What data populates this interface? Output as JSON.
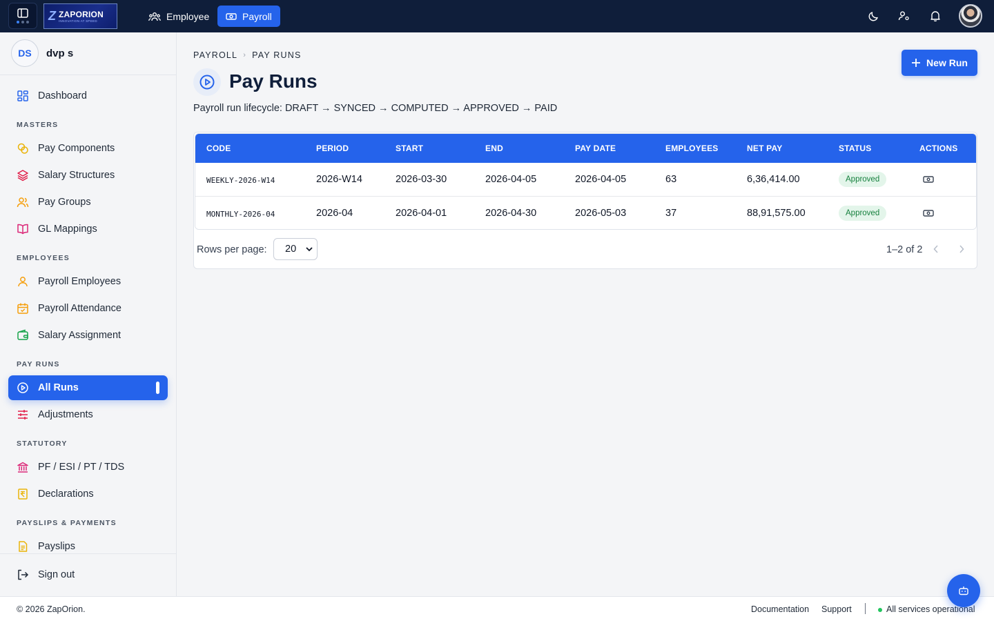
{
  "topbar": {
    "logo": {
      "name": "ZAPORION",
      "tagline": "INNOVATION AT SPEED"
    },
    "tabs": [
      {
        "label": "Employee",
        "icon": "users-icon",
        "active": false
      },
      {
        "label": "Payroll",
        "icon": "money-icon",
        "active": true
      }
    ],
    "icons": [
      "moon-icon",
      "user-settings-icon",
      "bell-icon"
    ]
  },
  "sidebar": {
    "user": {
      "initials": "DS",
      "name": "dvp s"
    },
    "dashboard": "Dashboard",
    "sections": [
      {
        "label": "MASTERS",
        "items": [
          "Pay Components",
          "Salary Structures",
          "Pay Groups",
          "GL Mappings"
        ]
      },
      {
        "label": "EMPLOYEES",
        "items": [
          "Payroll Employees",
          "Payroll Attendance",
          "Salary Assignment"
        ]
      },
      {
        "label": "PAY RUNS",
        "items": [
          "All Runs",
          "Adjustments"
        ]
      },
      {
        "label": "STATUTORY",
        "items": [
          "PF / ESI / PT / TDS",
          "Declarations"
        ]
      },
      {
        "label": "PAYSLIPS & PAYMENTS",
        "items": [
          "Payslips"
        ]
      }
    ],
    "active_item": "All Runs",
    "signout": "Sign out"
  },
  "main": {
    "breadcrumb": [
      "PAYROLL",
      "PAY RUNS"
    ],
    "title": "Pay Runs",
    "subtitle": "Payroll run lifecycle: DRAFT → SYNCED → COMPUTED → APPROVED → PAID",
    "new_button": "New Run",
    "table": {
      "columns": [
        "CODE",
        "PERIOD",
        "START",
        "END",
        "PAY DATE",
        "EMPLOYEES",
        "NET PAY",
        "STATUS",
        "ACTIONS"
      ],
      "rows": [
        {
          "code": "WEEKLY-2026-W14",
          "period": "2026-W14",
          "start": "2026-03-30",
          "end": "2026-04-05",
          "pay_date": "2026-04-05",
          "employees": "63",
          "net_pay": "6,36,414.00",
          "status": "Approved"
        },
        {
          "code": "MONTHLY-2026-04",
          "period": "2026-04",
          "start": "2026-04-01",
          "end": "2026-04-30",
          "pay_date": "2026-05-03",
          "employees": "37",
          "net_pay": "88,91,575.00",
          "status": "Approved"
        }
      ]
    },
    "pagination": {
      "rows_per_page_label": "Rows per page:",
      "rows_per_page": "20",
      "range": "1–2 of 2"
    }
  },
  "footer": {
    "copyright": "© 2026 ZapOrion.",
    "links": [
      "Documentation",
      "Support"
    ],
    "status": "All services operational"
  },
  "colors": {
    "primary": "#2563eb",
    "topbar": "#0f1e3a",
    "success": "#15803d"
  }
}
